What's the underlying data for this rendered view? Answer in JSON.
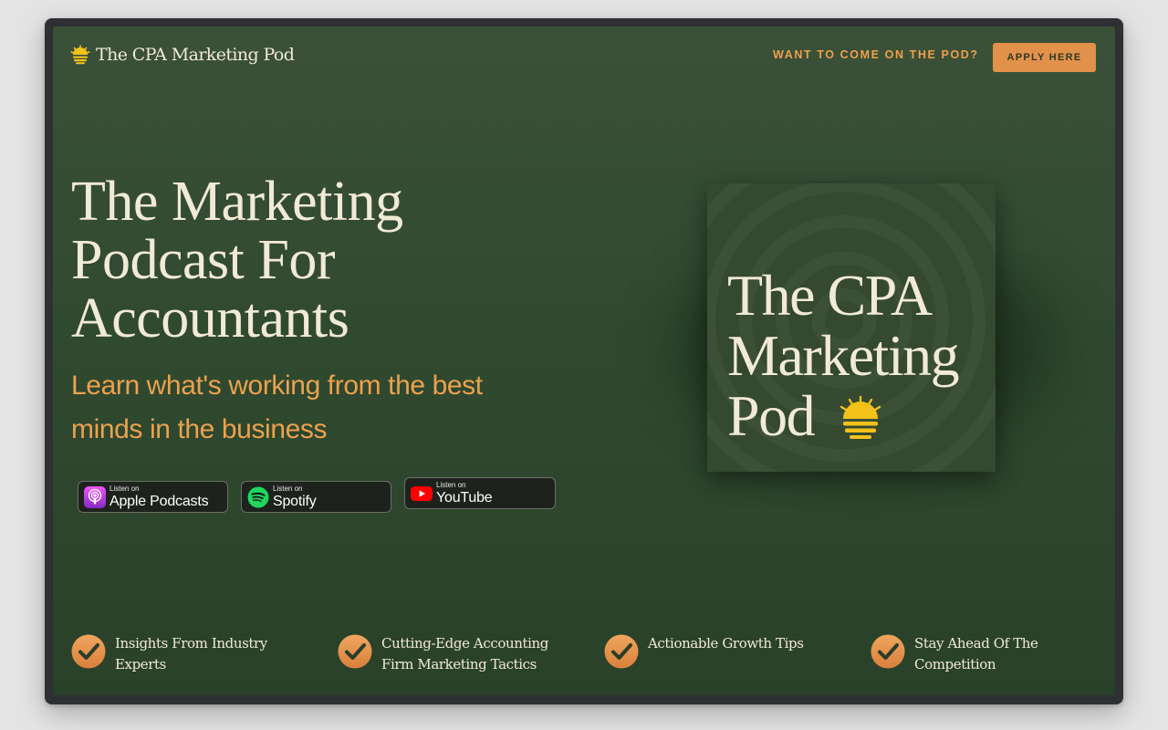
{
  "header": {
    "logo_text": "The CPA Marketing Pod",
    "cta_text": "WANT TO COME ON THE POD?",
    "apply_label": "APPLY HERE"
  },
  "hero": {
    "title": "The Marketing Podcast For Accountants",
    "subtitle": "Learn what's working from the best minds in the business"
  },
  "badges": [
    {
      "small": "Listen on",
      "name": "Apple Podcasts",
      "icon": "apple-podcasts-icon"
    },
    {
      "small": "Listen on",
      "name": "Spotify",
      "icon": "spotify-icon"
    },
    {
      "small": "Listen on",
      "name": "YouTube",
      "icon": "youtube-icon"
    }
  ],
  "cover": {
    "lines": [
      "The CPA",
      "Marketing",
      "Pod"
    ],
    "icon": "sun-icon"
  },
  "features": [
    {
      "text": "Insights From Industry Experts",
      "icon": "check-icon"
    },
    {
      "text": "Cutting-Edge Accounting Firm Marketing Tactics",
      "icon": "check-icon"
    },
    {
      "text": "Actionable Growth Tips",
      "icon": "check-icon"
    },
    {
      "text": "Stay Ahead Of The Competition",
      "icon": "check-icon"
    }
  ],
  "colors": {
    "background": "#304a30",
    "accent": "#e2914a",
    "cream": "#f1ead6",
    "sun_yellow": "#f2c21a"
  }
}
